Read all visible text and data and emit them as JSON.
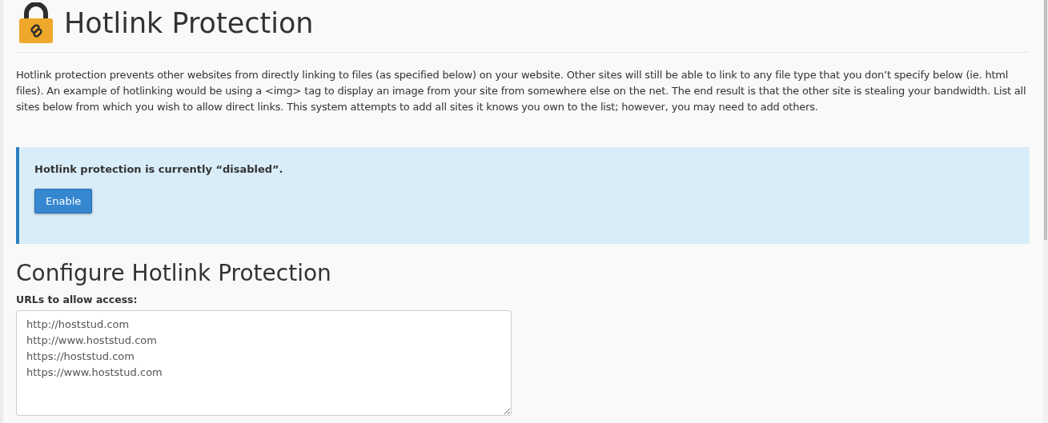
{
  "page": {
    "title": "Hotlink Protection",
    "description": "Hotlink protection prevents other websites from directly linking to files (as specified below) on your website. Other sites will still be able to link to any file type that you don’t specify below (ie. html files). An example of hotlinking would be using a <img> tag to display an image from your site from somewhere else on the net. The end result is that the other site is stealing your bandwidth. List all sites below from which you wish to allow direct links. This system attempts to add all sites it knows you own to the list; however, you may need to add others."
  },
  "status": {
    "message": "Hotlink protection is currently “disabled”.",
    "button": "Enable"
  },
  "configure": {
    "heading": "Configure Hotlink Protection",
    "urls_label": "URLs to allow access:",
    "urls": [
      "http://hoststud.com",
      "http://www.hoststud.com",
      "https://hoststud.com",
      "https://www.hoststud.com"
    ]
  }
}
